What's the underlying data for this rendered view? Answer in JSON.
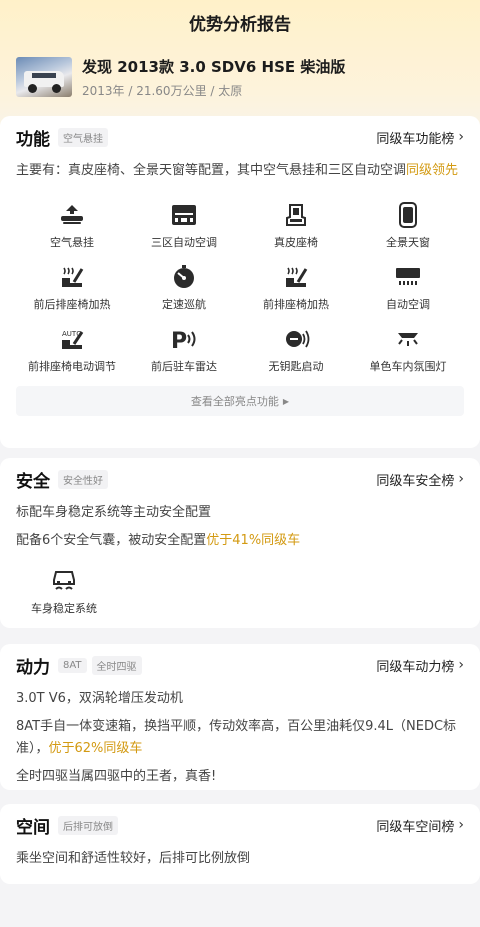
{
  "header": {
    "title": "优势分析报告"
  },
  "car": {
    "name": "发现 2013款 3.0 SDV6 HSE 柴油版",
    "meta": "2013年 / 21.60万公里 / 太原"
  },
  "function_section": {
    "title": "功能",
    "tag": "空气悬挂",
    "rank_label": "同级车功能榜",
    "desc_main": "主要有：真皮座椅、全景天窗等配置，其中空气悬挂和三区自动空调",
    "desc_highlight": "同级领先",
    "features": [
      {
        "label": "空气悬挂",
        "icon": "air-suspension-icon"
      },
      {
        "label": "三区自动空调",
        "icon": "tri-zone-ac-icon"
      },
      {
        "label": "真皮座椅",
        "icon": "leather-seat-icon"
      },
      {
        "label": "全景天窗",
        "icon": "panoramic-sunroof-icon"
      },
      {
        "label": "前后排座椅加热",
        "icon": "seat-heating-icon"
      },
      {
        "label": "定速巡航",
        "icon": "cruise-control-icon"
      },
      {
        "label": "前排座椅加热",
        "icon": "front-seat-heating-icon"
      },
      {
        "label": "自动空调",
        "icon": "auto-ac-icon"
      },
      {
        "label": "前排座椅电动调节",
        "icon": "power-seat-icon"
      },
      {
        "label": "前后驻车雷达",
        "icon": "parking-radar-icon"
      },
      {
        "label": "无钥匙启动",
        "icon": "keyless-start-icon"
      },
      {
        "label": "单色车内氛围灯",
        "icon": "ambient-light-icon"
      }
    ],
    "more_label": "查看全部亮点功能"
  },
  "safety_section": {
    "title": "安全",
    "tag": "安全性好",
    "rank_label": "同级车安全榜",
    "line1": "标配车身稳定系统等主动安全配置",
    "line2_main": "配备6个安全气囊，被动安全配置",
    "line2_highlight": "优于41%同级车",
    "feature": {
      "label": "车身稳定系统",
      "icon": "stability-control-icon"
    }
  },
  "power_section": {
    "title": "动力",
    "tags": [
      "8AT",
      "全时四驱"
    ],
    "rank_label": "同级车动力榜",
    "line1": "3.0T V6，双涡轮增压发动机",
    "line2_main": "8AT手自一体变速箱，换挡平顺，传动效率高，百公里油耗仅9.4L（NEDC标准），",
    "line2_highlight": "优于62%同级车",
    "line3": "全时四驱当属四驱中的王者，真香!"
  },
  "space_section": {
    "title": "空间",
    "tag": "后排可放倒",
    "rank_label": "同级车空间榜",
    "line1": "乘坐空间和舒适性较好，后排可比例放倒"
  },
  "colors": {
    "accent": "#d39a12",
    "icon": "#2b2b2b"
  }
}
